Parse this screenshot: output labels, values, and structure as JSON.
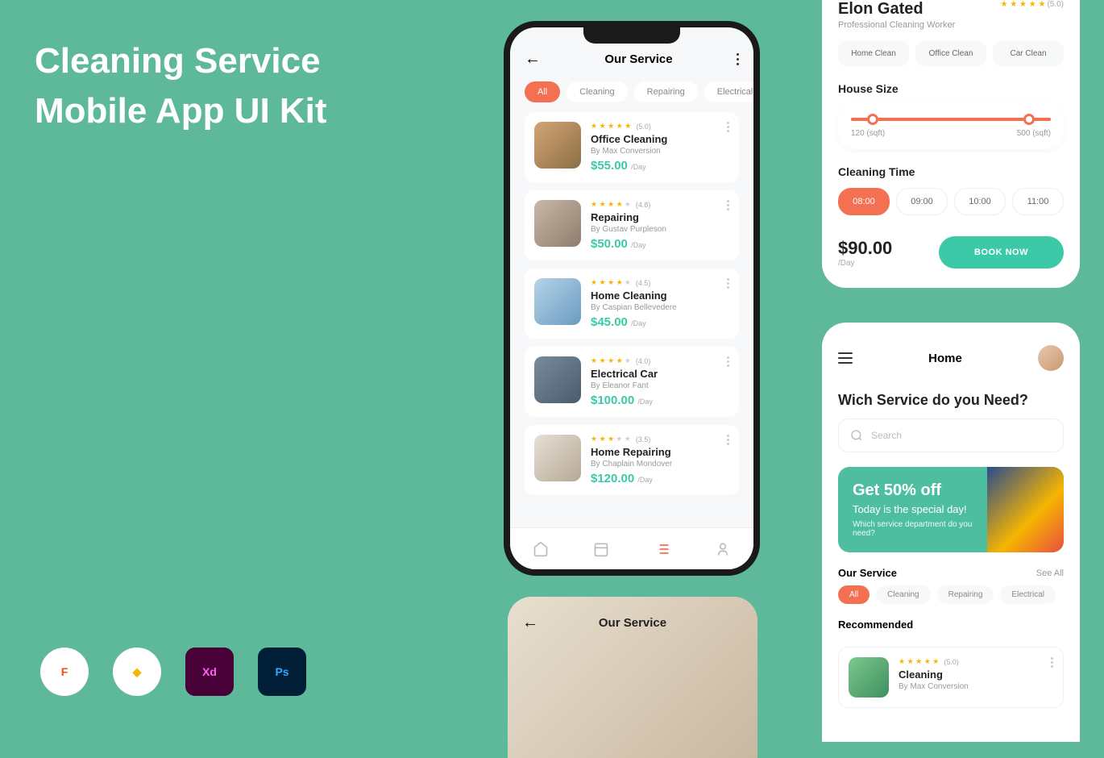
{
  "hero": {
    "line1": "Cleaning Service",
    "line2": "Mobile App UI Kit"
  },
  "tools": {
    "figma": "F",
    "sketch": "◆",
    "xd": "Xd",
    "ps": "Ps"
  },
  "phone1": {
    "title": "Our Service",
    "tabs": [
      "All",
      "Cleaning",
      "Repairing",
      "Electrical"
    ],
    "services": [
      {
        "name": "Office Cleaning",
        "by": "By Max Conversion",
        "price": "$55.00",
        "unit": "/Day",
        "rating": "(5.0)",
        "stars": 5
      },
      {
        "name": "Repairing",
        "by": "By Gustav Purpleson",
        "price": "$50.00",
        "unit": "/Day",
        "rating": "(4.8)",
        "stars": 4
      },
      {
        "name": "Home Cleaning",
        "by": "By Caspian Bellevedere",
        "price": "$45.00",
        "unit": "/Day",
        "rating": "(4.5)",
        "stars": 4
      },
      {
        "name": "Electrical Car",
        "by": "By Eleanor Fant",
        "price": "$100.00",
        "unit": "/Day",
        "rating": "(4.0)",
        "stars": 4
      },
      {
        "name": "Home Repairing",
        "by": "By Chaplain Mondover",
        "price": "$120.00",
        "unit": "/Day",
        "rating": "(3.5)",
        "stars": 3
      }
    ]
  },
  "phone2": {
    "title": "Our Service"
  },
  "phone3": {
    "name": "Elon Gated",
    "subtitle": "Professional Cleaning Worker",
    "rating": "(5.0)",
    "chips": [
      "Home Clean",
      "Office Clean",
      "Car Clean"
    ],
    "house_size_label": "House Size",
    "slider": {
      "min": "120 (sqft)",
      "max": "500 (sqft)"
    },
    "cleaning_time_label": "Cleaning Time",
    "times": [
      "08:00",
      "09:00",
      "10:00",
      "11:00"
    ],
    "price": "$90.00",
    "price_unit": "/Day",
    "book_btn": "BOOK NOW"
  },
  "phone4": {
    "title": "Home",
    "heading": "Wich Service do you Need?",
    "search_placeholder": "Search",
    "promo": {
      "title": "Get 50% off",
      "subtitle": "Today is the special day!",
      "desc": "Which service department do you need?"
    },
    "our_service_label": "Our Service",
    "see_all": "See All",
    "tabs": [
      "All",
      "Cleaning",
      "Repairing",
      "Electrical"
    ],
    "recommended_label": "Recommended",
    "rec": {
      "name": "Cleaning",
      "by": "By Max Conversion",
      "rating": "(5.0)"
    }
  }
}
